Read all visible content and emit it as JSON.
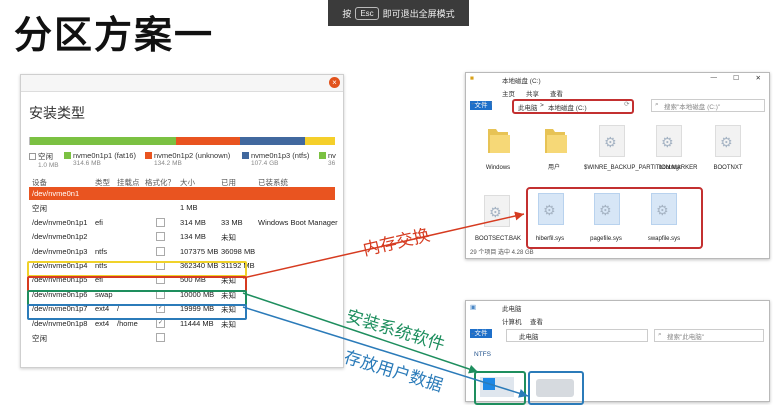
{
  "slide": {
    "title": "分区方案一"
  },
  "banner": {
    "press": "按",
    "key": "Esc",
    "text": "即可退出全屏模式"
  },
  "installer": {
    "title": "安装类型",
    "colors": {
      "free": "#ffffff",
      "p1": "#7bc142",
      "p2": "#e95420",
      "p3": "#41689e",
      "p4": "#f5cf2a"
    },
    "legend": [
      {
        "label": "空闲",
        "sub": "1.0 MB",
        "color": "#ffffff"
      },
      {
        "label": "nvme0n1p1 (fat16)",
        "sub": "314.6 MB",
        "color": "#7bc142"
      },
      {
        "label": "nvme0n1p2 (unknown)",
        "sub": "134.2 MB",
        "color": "#e95420"
      },
      {
        "label": "nvme0n1p3 (ntfs)",
        "sub": "107.4 GB",
        "color": "#41689e"
      },
      {
        "label": "nv",
        "sub": "36",
        "color": "#7bc142"
      }
    ],
    "headers": {
      "device": "设备",
      "type": "类型",
      "mount": "挂载点",
      "format": "格式化？",
      "size": "大小",
      "used": "已用",
      "system": "已装系统"
    },
    "rows": [
      {
        "device": "/dev/nvme0n1",
        "type": "",
        "mount": "",
        "check": "",
        "size": "",
        "used": "",
        "system": ""
      },
      {
        "device": "空闲",
        "type": "",
        "mount": "",
        "check": "",
        "size": "1 MB",
        "used": "",
        "system": ""
      },
      {
        "device": "/dev/nvme0n1p1",
        "type": "efi",
        "mount": "",
        "check": "",
        "size": "314 MB",
        "used": "33 MB",
        "system": "Windows Boot Manager"
      },
      {
        "device": "/dev/nvme0n1p2",
        "type": "",
        "mount": "",
        "check": "",
        "size": "134 MB",
        "used": "未知",
        "system": ""
      },
      {
        "device": "/dev/nvme0n1p3",
        "type": "ntfs",
        "mount": "",
        "check": "",
        "size": "107375 MB",
        "used": "36098 MB",
        "system": ""
      },
      {
        "device": "/dev/nvme0n1p4",
        "type": "ntfs",
        "mount": "",
        "check": "",
        "size": "362340 MB",
        "used": "31192 MB",
        "system": ""
      },
      {
        "device": "/dev/nvme0n1p5",
        "type": "efi",
        "mount": "",
        "check": "",
        "size": "500 MB",
        "used": "未知",
        "system": ""
      },
      {
        "device": "/dev/nvme0n1p6",
        "type": "swap",
        "mount": "",
        "check": "",
        "size": "10000 MB",
        "used": "未知",
        "system": ""
      },
      {
        "device": "/dev/nvme0n1p7",
        "type": "ext4",
        "mount": "/",
        "check": "✓",
        "size": "19999 MB",
        "used": "未知",
        "system": ""
      },
      {
        "device": "/dev/nvme0n1p8",
        "type": "ext4",
        "mount": "/home",
        "check": "✓",
        "size": "11444 MB",
        "used": "未知",
        "system": ""
      },
      {
        "device": "空闲",
        "type": "",
        "mount": "",
        "check": "",
        "size": "",
        "used": "",
        "system": ""
      }
    ]
  },
  "explorer1": {
    "title": "本地磁盘 (C:)",
    "tabs": [
      "文件",
      "主页",
      "共享",
      "查看"
    ],
    "path": [
      "此电脑",
      "本地磁盘 (C:)"
    ],
    "search": "搜索\"本地磁盘 (C:)\"",
    "items": [
      "Windows",
      "用户",
      "$WINRE_BACKUP_PARTITION.MARKER",
      "bootmgr",
      "BOOTNXT",
      "BOOTSECT.BAK",
      "hiberfil.sys",
      "pagefile.sys",
      "swapfile.sys"
    ],
    "status": "29 个项目    选中 4.28 GB"
  },
  "explorer2": {
    "title": "此电脑",
    "tabs": [
      "文件",
      "计算机",
      "查看"
    ],
    "path": [
      "此电脑"
    ],
    "search": "搜索\"此电脑\"",
    "section": "NTFS"
  },
  "annotations": {
    "memory_swap": "内存交换",
    "install_system": "安装系统软件",
    "store_data": "存放用户数据"
  }
}
